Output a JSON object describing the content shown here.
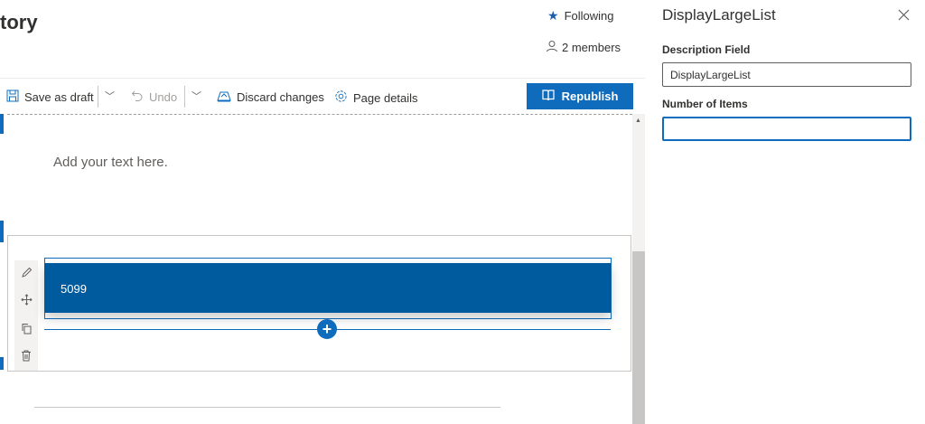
{
  "page": {
    "title": "tory"
  },
  "header": {
    "following_label": "Following",
    "members_label": "2 members"
  },
  "toolbar": {
    "save_draft_label": "Save as draft",
    "undo_label": "Undo",
    "discard_label": "Discard changes",
    "page_details_label": "Page details",
    "republish_label": "Republish"
  },
  "canvas": {
    "text_placeholder": "Add your text here.",
    "webpart_value": "5099"
  },
  "panel": {
    "title": "DisplayLargeList",
    "description_label": "Description Field",
    "description_value": "DisplayLargeList",
    "items_label": "Number of Items",
    "items_value": ""
  },
  "colors": {
    "accent": "#0f6cbd",
    "banner": "#005a9e"
  }
}
